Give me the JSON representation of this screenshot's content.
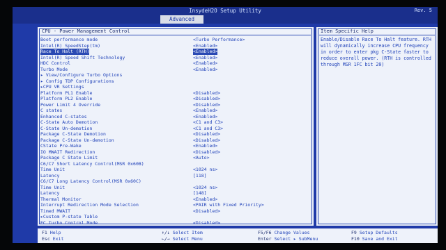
{
  "header": {
    "title": "InsydeH2O Setup Utility",
    "revision": "Rev. 5"
  },
  "tabs": [
    {
      "label": "Advanced"
    }
  ],
  "panel": {
    "title": "CPU - Power Management Control"
  },
  "rows": [
    {
      "label": "Boot performance mode",
      "value": "<Turbo Performance>"
    },
    {
      "label": "Intel(R) SpeedStep(tm)",
      "value": "<Enabled>"
    },
    {
      "label": "Race To Halt (RTH)",
      "value": "<Enabled>"
    },
    {
      "label": "Intel(R) Speed Shift Technology",
      "value": "<Enabled>"
    },
    {
      "label": "HDC Control",
      "value": "<Enabled>"
    },
    {
      "label": "  Turbo Mode",
      "value": "<Enabled>"
    },
    {
      "label": "▸ View/Configure Turbo Options",
      "value": ""
    },
    {
      "label": "▸ Config TDP Configurations",
      "value": ""
    },
    {
      "label": "▸CPU VR Settings",
      "value": ""
    },
    {
      "label": "Platform PL1 Enable",
      "value": "<Disabled>"
    },
    {
      "label": "Platform PL2 Enable",
      "value": "<Disabled>"
    },
    {
      "label": "Power Limit 4 Override",
      "value": "<Disabled>"
    },
    {
      "label": "C states",
      "value": "<Enabled>"
    },
    {
      "label": "  Enhanced C-states",
      "value": "<Enabled>"
    },
    {
      "label": "  C-State Auto Demotion",
      "value": "<C1 and C3>"
    },
    {
      "label": "  C-State Un-demotion",
      "value": "<C1 and C3>"
    },
    {
      "label": "  Package C-State Demotion",
      "value": "<Disabled>"
    },
    {
      "label": "  Package C-State Un-demotion",
      "value": "<Disabled>"
    },
    {
      "label": "CState Pre-Wake",
      "value": "<Enabled>"
    },
    {
      "label": "IO MWAIT Redirection",
      "value": "<Disabled>"
    },
    {
      "label": "Package C State Limit",
      "value": "<Auto>"
    },
    {
      "label": "C6/C7 Short Latency Control(MSR 0x60B)",
      "value": ""
    },
    {
      "label": "Time Unit",
      "value": "<1024 ns>"
    },
    {
      "label": "Latency",
      "value": "[118]"
    },
    {
      "label": "C6/C7 Long Latency Control(MSR 0x60C)",
      "value": ""
    },
    {
      "label": "Time Unit",
      "value": "<1024 ns>"
    },
    {
      "label": "Latency",
      "value": "[148]"
    },
    {
      "label": "Thermal Monitor",
      "value": "<Enabled>"
    },
    {
      "label": "Interrupt Redirection Mode Selection",
      "value": "<PAIR with Fixed Priority>"
    },
    {
      "label": "Timed MWAIT",
      "value": "<Disabled>"
    },
    {
      "label": "▸Custom P-state Table",
      "value": ""
    },
    {
      "label": "EC Turbo Control Mode",
      "value": "<Disabled>"
    }
  ],
  "selected_row": 2,
  "help": {
    "title": "Item Specific Help",
    "text": "Enable/Disable Race To Halt feature. RTH will dynamically increase CPU frequency in order to enter pkg C-State faster to reduce overall power. (RTH is controlled through MSR 1FC bit 20)"
  },
  "footer": {
    "f1_key": "F1",
    "f1_desc": "Help",
    "esc_key": "Esc",
    "esc_desc": "Exit",
    "updown_key": "↑/↓",
    "updown_desc": "Select Item",
    "leftright_key": "←/→",
    "leftright_desc": "Select Menu",
    "f5f6_key": "F5/F6",
    "f5f6_desc": "Change Values",
    "enter_key": "Enter",
    "enter_desc": "Select ▸ SubMenu",
    "f9_key": "F9",
    "f9_desc": "Setup Defaults",
    "f10_key": "F10",
    "f10_desc": "Save and Exit"
  }
}
